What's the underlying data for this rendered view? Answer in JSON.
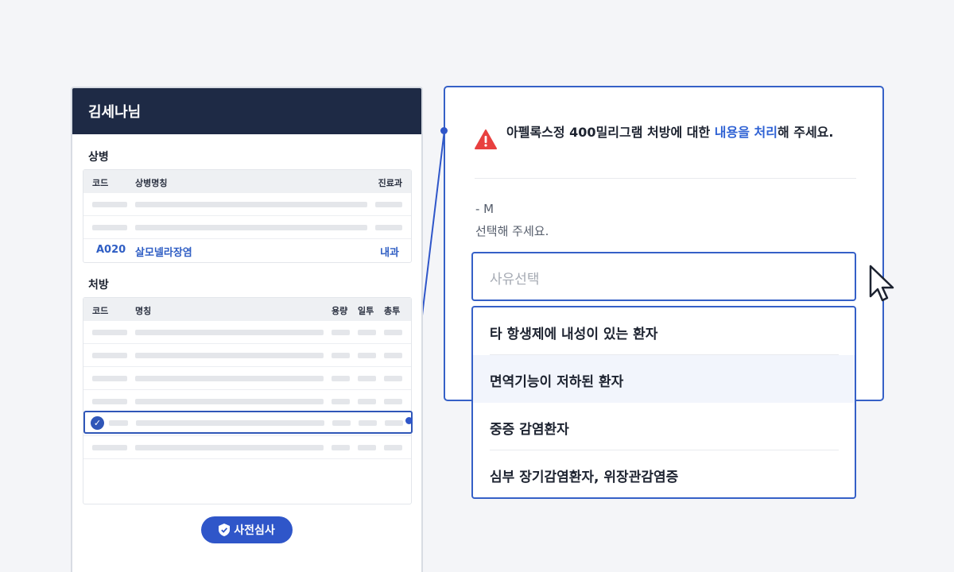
{
  "patient": {
    "name": "김세나님",
    "diagnosis": {
      "title": "상병",
      "columns": [
        "코드",
        "상병명칭",
        "진료과"
      ],
      "highlighted": {
        "code": "A020",
        "name": "살모넬라장염",
        "dept": "내과"
      }
    },
    "prescription": {
      "title": "처방",
      "columns": [
        "코드",
        "명칭",
        "용량",
        "일투",
        "총투"
      ]
    },
    "review_button": "사전심사"
  },
  "alert": {
    "message_pre": "아펠록스정 400밀리그램 처방에 대한 ",
    "message_link": "내용을 처리",
    "message_post": "해 주세요.",
    "guide_line1": "- M",
    "guide_line2": "선택해 주세요."
  },
  "reason_select": {
    "placeholder": "사유선택",
    "options": [
      "타 항생제에 내성이 있는 환자",
      "면역기능이 저하된 환자",
      "중증 감염환자",
      "심부 장기감염환자, 위장관감염증"
    ]
  }
}
